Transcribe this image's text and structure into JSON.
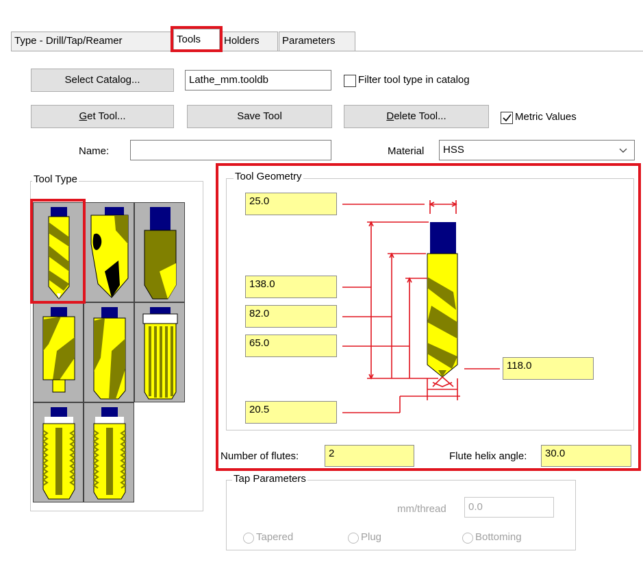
{
  "tabs": [
    {
      "label": "Type - Drill/Tap/Reamer"
    },
    {
      "label": "Tools"
    },
    {
      "label": "Holders"
    },
    {
      "label": "Parameters"
    }
  ],
  "catalog": {
    "select_label": "Select Catalog...",
    "file_value": "Lathe_mm.tooldb",
    "filter_label": "Filter tool type in catalog",
    "filter_checked": false
  },
  "actions": {
    "get_tool_underline": "G",
    "get_tool_rest": "et Tool...",
    "save_tool": "Save Tool",
    "delete_tool_underline": "D",
    "delete_tool_rest": "elete Tool...",
    "metric_label": "Metric Values",
    "metric_checked": true
  },
  "name": {
    "label": "Name:",
    "value": ""
  },
  "material": {
    "label": "Material",
    "value": "HSS"
  },
  "tool_type": {
    "title": "Tool Type",
    "tiles": [
      "twist-drill",
      "spot-drill",
      "center-drill",
      "step-drill",
      "core-drill",
      "reamer",
      "tap-tapered",
      "tap-plug"
    ]
  },
  "geometry": {
    "title": "Tool Geometry",
    "shank_diameter": "25.0",
    "overall_length": "138.0",
    "body_length": "82.0",
    "flute_length": "65.0",
    "diameter": "20.5",
    "point_angle": "118.0",
    "flutes_label": "Number of flutes:",
    "flutes_value": "2",
    "helix_label": "Flute helix angle:",
    "helix_value": "30.0"
  },
  "tap": {
    "title": "Tap Parameters",
    "thread_label": "mm/thread",
    "thread_value": "0.0",
    "options": [
      "Tapered",
      "Plug",
      "Bottoming"
    ]
  },
  "colors": {
    "highlight": "#e0141e",
    "field_yellow": "#ffff99",
    "tool_yellow": "#ffff00",
    "tool_olive": "#808000",
    "shank_navy": "#000080"
  }
}
